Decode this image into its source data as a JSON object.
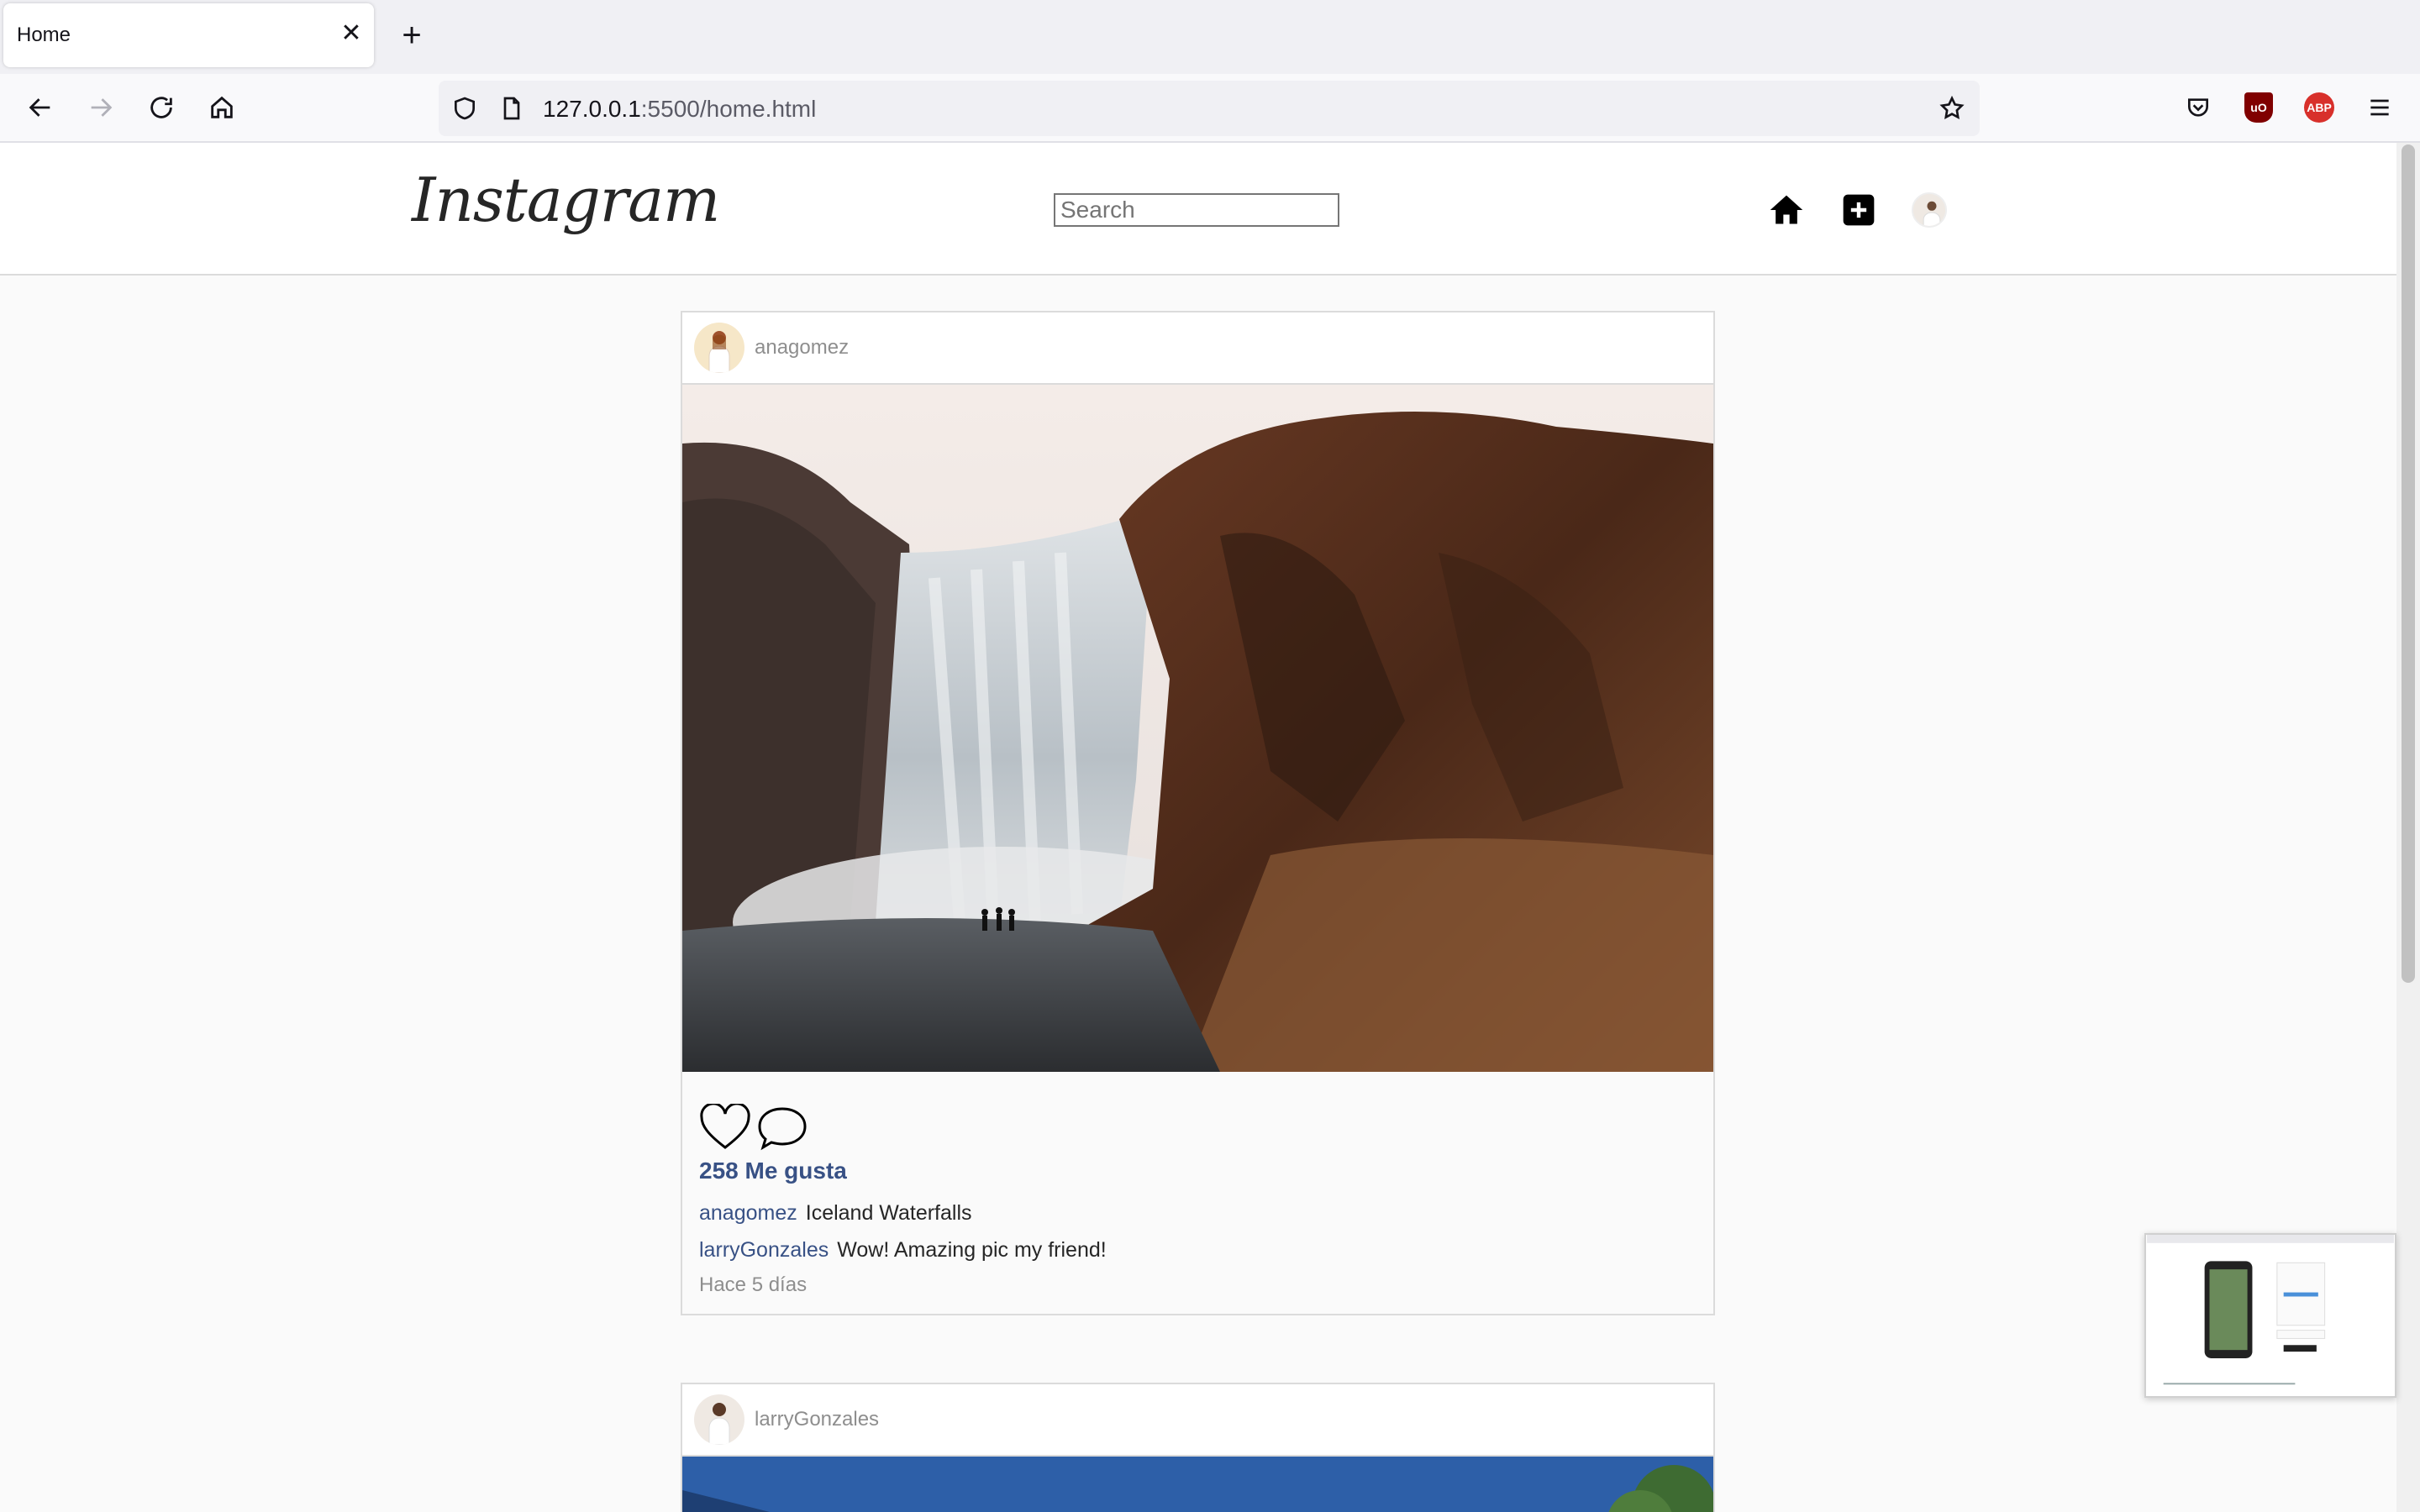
{
  "browser": {
    "tab_title": "Home",
    "url_host": "127.0.0.1",
    "url_rest": ":5500/home.html"
  },
  "instagram": {
    "logo": "Instagram",
    "search_placeholder": "Search"
  },
  "posts": [
    {
      "username": "anagomez",
      "likes": "258 Me gusta",
      "caption_user": "anagomez",
      "caption": "Iceland Waterfalls",
      "comment_user": "larryGonzales",
      "comment": "Wow! Amazing pic my friend!",
      "time_ago": "Hace 5 días"
    },
    {
      "username": "larryGonzales"
    }
  ],
  "colors": {
    "link_blue": "#385185",
    "muted_gray": "#8e8e8e",
    "border": "#dbdbdb"
  }
}
